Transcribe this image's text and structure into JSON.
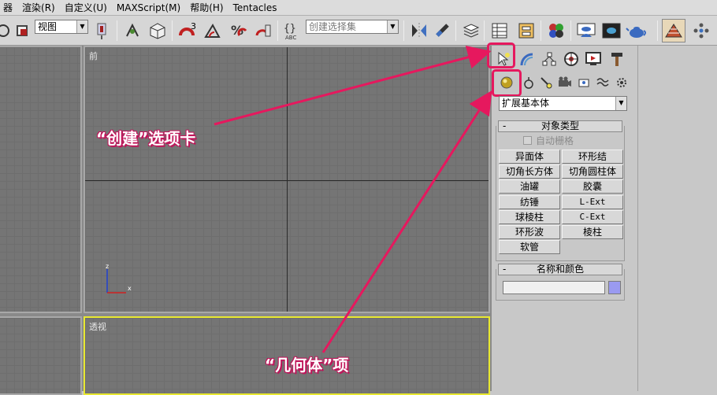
{
  "menubar": {
    "items": [
      "器",
      "渲染(R)",
      "自定义(U)",
      "MAXScript(M)",
      "帮助(H)",
      "Tentacles"
    ]
  },
  "toolbar": {
    "view_combo": "视图",
    "selection_set_placeholder": "创建选择集",
    "snap_3": "3"
  },
  "viewports": {
    "front_label": "前",
    "perspective_label": "透视",
    "axis_z": "z",
    "axis_x": "x"
  },
  "command_panel": {
    "category_dropdown": "扩展基本体",
    "object_type": {
      "title": "对象类型",
      "collapse": "-",
      "autogrid_label": "自动栅格",
      "buttons": [
        "异面体",
        "环形结",
        "切角长方体",
        "切角圆柱体",
        "油罐",
        "胶囊",
        "纺锤",
        "L-Ext",
        "球棱柱",
        "C-Ext",
        "环形波",
        "棱柱",
        "软管"
      ]
    },
    "name_color": {
      "title": "名称和颜色",
      "collapse": "-",
      "name_value": "",
      "color_swatch": "#9a9af0"
    }
  },
  "annotations": {
    "create_tab": "“创建”选项卡",
    "geometry_item": "“几何体”项"
  },
  "colors": {
    "highlight": "#e6185e",
    "viewport_active_border": "#e8e830"
  }
}
